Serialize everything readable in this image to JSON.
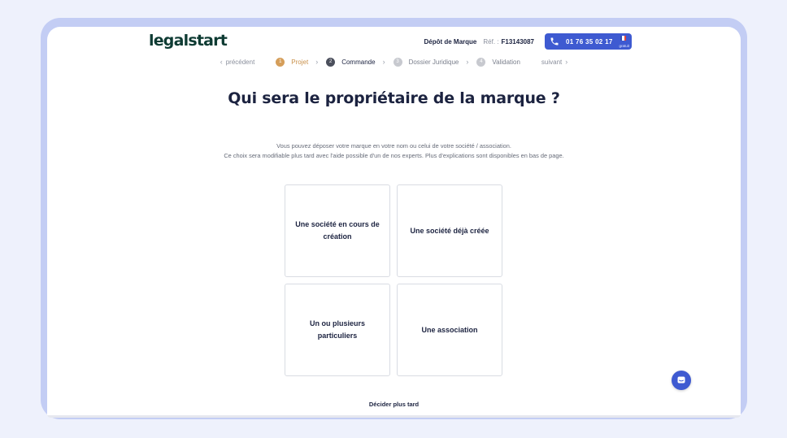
{
  "brand": {
    "logo": "legalstart"
  },
  "header": {
    "title": "Dépôt de Marque",
    "ref_label": "Réf. :",
    "ref_value": "F13143087",
    "phone": "01 76 35 02 17",
    "phone_note": "gratuit",
    "phone_color": "#3e5ad1"
  },
  "stepper": {
    "prev": "précédent",
    "next": "suivant",
    "steps": [
      {
        "num": "1",
        "label": "Projet",
        "state": "active"
      },
      {
        "num": "2",
        "label": "Commande",
        "state": "current"
      },
      {
        "num": "3",
        "label": "Dossier Juridique",
        "state": "todo"
      },
      {
        "num": "4",
        "label": "Validation",
        "state": "todo"
      }
    ]
  },
  "main": {
    "title": "Qui sera le propriétaire de la marque ?",
    "intro_line1": "Vous pouvez déposer votre marque en votre nom ou celui de votre société / association.",
    "intro_line2": "Ce choix sera modifiable plus tard avec l'aide possible d'un de nos experts. Plus d'explications sont disponibles en bas de page.",
    "options": [
      "Une société en cours de création",
      "Une société déjà créée",
      "Un ou plusieurs particuliers",
      "Une association"
    ],
    "later_link": "Décider plus tard"
  },
  "icons": {
    "phone": "phone-icon",
    "flag": "french-flag-icon",
    "chat": "chat-icon"
  }
}
